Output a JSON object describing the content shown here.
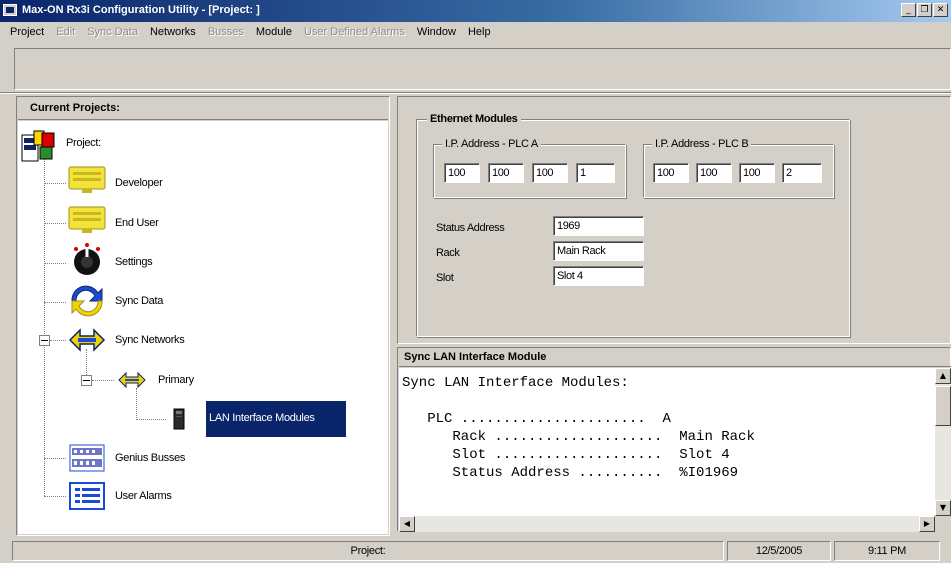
{
  "window": {
    "title": "Max-ON Rx3i Configuration Utility - [Project: ]"
  },
  "menu": [
    {
      "label": "Project",
      "enabled": true
    },
    {
      "label": "Edit",
      "enabled": false
    },
    {
      "label": "Sync Data",
      "enabled": false
    },
    {
      "label": "Networks",
      "enabled": true
    },
    {
      "label": "Busses",
      "enabled": false
    },
    {
      "label": "Module",
      "enabled": true
    },
    {
      "label": "User Defined Alarms",
      "enabled": false
    },
    {
      "label": "Window",
      "enabled": true
    },
    {
      "label": "Help",
      "enabled": true
    }
  ],
  "left_pane": {
    "header": "Current Projects:",
    "tree": {
      "project": "Project:",
      "developer": "Developer",
      "end_user": "End User",
      "settings": "Settings",
      "sync_data": "Sync Data",
      "sync_networks": "Sync Networks",
      "primary": "Primary",
      "lan_interface_modules": "LAN Interface Modules",
      "genius_busses": "Genius Busses",
      "user_alarms": "User Alarms"
    }
  },
  "ethernet": {
    "group_label": "Ethernet Modules",
    "plc_a": {
      "label": "I.P. Address - PLC A",
      "octets": [
        "100",
        "100",
        "100",
        "1"
      ]
    },
    "plc_b": {
      "label": "I.P. Address - PLC B",
      "octets": [
        "100",
        "100",
        "100",
        "2"
      ]
    },
    "status_address": {
      "label": "Status Address",
      "value": "1969"
    },
    "rack": {
      "label": "Rack",
      "value": "Main Rack"
    },
    "slot": {
      "label": "Slot",
      "value": "Slot 4"
    }
  },
  "sync_lan": {
    "header": "Sync LAN Interface Module",
    "lines": [
      "Sync LAN Interface Modules:",
      "",
      "   PLC ......................  A",
      "      Rack ....................  Main Rack",
      "      Slot ....................  Slot 4",
      "      Status Address ..........  %I01969"
    ]
  },
  "statusbar": {
    "text": "Project:",
    "date": "12/5/2005",
    "time": "9:11 PM"
  },
  "colors": {
    "title_active": "#0a246a",
    "face": "#d4d0c8",
    "selection": "#0a246a"
  }
}
